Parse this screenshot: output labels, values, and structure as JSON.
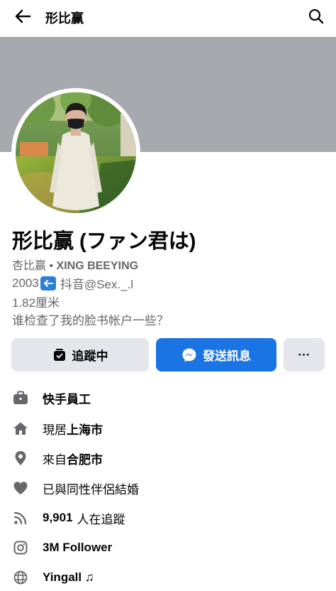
{
  "topbar": {
    "title": "形比赢"
  },
  "profile": {
    "name": "形比赢 (ファン君は)",
    "alt_name_prefix": "杏比赢 •",
    "alt_name_bold": "XING BEEYING",
    "bio": {
      "line1_a": "2003",
      "line1_b": "抖音@Sex._.l",
      "line2": "1.82厘米",
      "line3": "谁检查了我的脸书帐户一些？"
    }
  },
  "actions": {
    "following_label": "追蹤中",
    "message_label": "發送訊息",
    "more_label": "···"
  },
  "info": {
    "work": "快手員工",
    "lives_prefix": "現居",
    "lives_city": "上海市",
    "from_prefix": "來自",
    "from_city": "合肥市",
    "relationship": "已與同性伴侶結婚",
    "followers_count": "9,901",
    "followers_suffix": "人在追蹤",
    "instagram": "3M Follower",
    "website": "Yingall ♫"
  },
  "icons": {
    "back": "arrow-left-icon",
    "search": "search-icon",
    "avatar_badge": "arrow-left-badge-icon",
    "following": "following-check-icon",
    "messenger": "messenger-icon",
    "briefcase": "briefcase-icon",
    "home": "home-icon",
    "location": "location-pin-icon",
    "heart": "heart-icon",
    "rss": "rss-icon",
    "instagram": "instagram-icon",
    "globe": "globe-icon"
  },
  "colors": {
    "primary": "#1b74e4",
    "button_gray": "#e4e6eb",
    "cover_gray": "#a6a9ae",
    "secondary_text": "#65676b"
  }
}
